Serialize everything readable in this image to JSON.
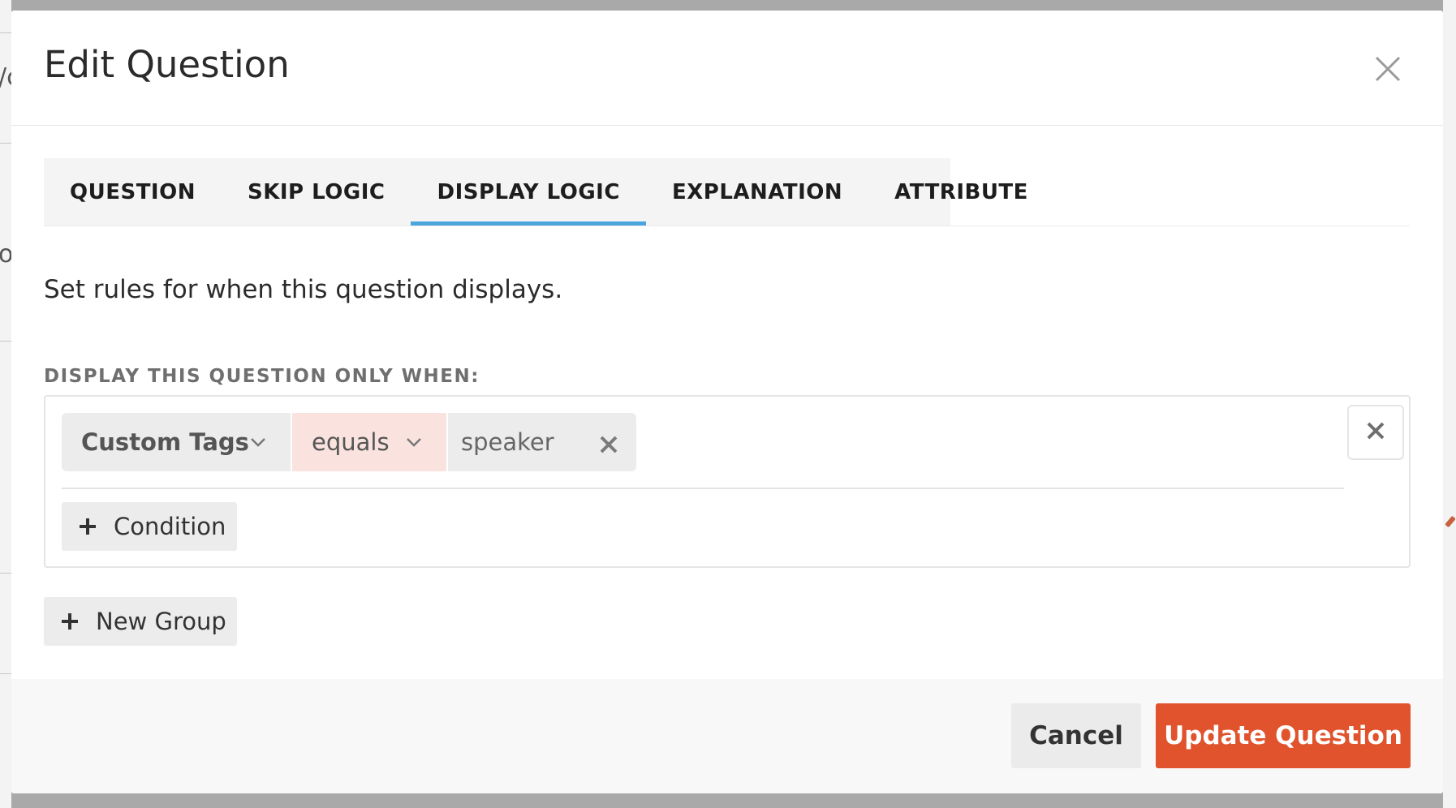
{
  "modal": {
    "title": "Edit Question"
  },
  "tabs": [
    {
      "label": "QUESTION",
      "active": false
    },
    {
      "label": "SKIP LOGIC",
      "active": false
    },
    {
      "label": "DISPLAY LOGIC",
      "active": true
    },
    {
      "label": "EXPLANATION",
      "active": false
    },
    {
      "label": "ATTRIBUTE",
      "active": false
    }
  ],
  "display_logic": {
    "intro": "Set rules for when this question displays.",
    "section_label": "DISPLAY THIS QUESTION ONLY WHEN:",
    "group": {
      "condition": {
        "field": "Custom Tags",
        "operator": "equals",
        "value": "speaker"
      },
      "add_condition_label": "Condition"
    },
    "new_group_label": "New Group"
  },
  "footer": {
    "cancel_label": "Cancel",
    "submit_label": "Update Question"
  },
  "colors": {
    "accent_tab": "#4aa5dd",
    "primary_button": "#e0532c",
    "operator_bg": "#fae3de"
  }
}
